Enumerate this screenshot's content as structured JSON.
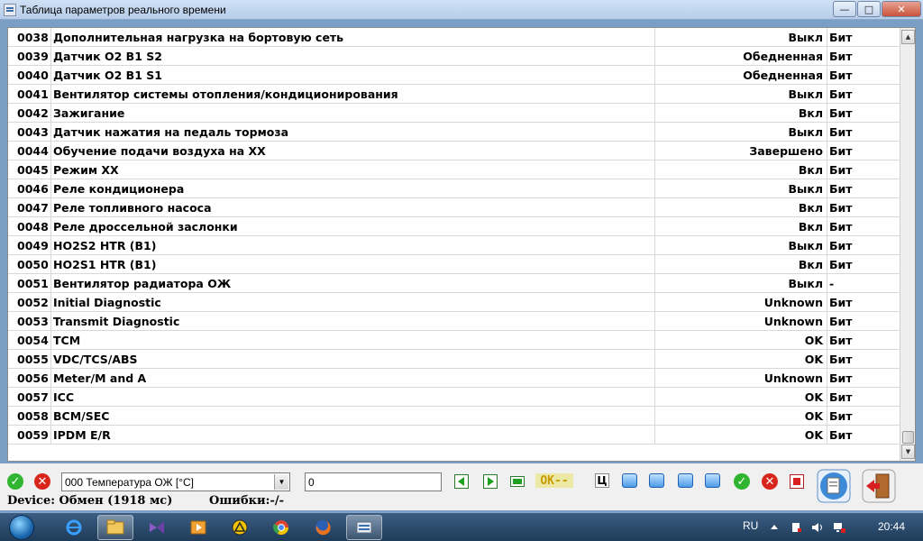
{
  "window": {
    "title": "Таблица параметров реального времени",
    "min_label": "—",
    "max_label": "□",
    "close_label": "✕"
  },
  "table": {
    "rows": [
      {
        "num": "0038",
        "name": "Дополнительная нагрузка на бортовую сеть",
        "value": "Выкл",
        "unit": "Бит"
      },
      {
        "num": "0039",
        "name": "Датчик O2 B1 S2",
        "value": "Обедненная",
        "unit": "Бит"
      },
      {
        "num": "0040",
        "name": "Датчик O2 B1 S1",
        "value": "Обедненная",
        "unit": "Бит"
      },
      {
        "num": "0041",
        "name": "Вентилятор системы отопления/кондиционирования",
        "value": "Выкл",
        "unit": "Бит"
      },
      {
        "num": "0042",
        "name": "Зажигание",
        "value": "Вкл",
        "unit": "Бит"
      },
      {
        "num": "0043",
        "name": "Датчик нажатия на педаль тормоза",
        "value": "Выкл",
        "unit": "Бит"
      },
      {
        "num": "0044",
        "name": "Обучение подачи воздуха на ХХ",
        "value": "Завершено",
        "unit": "Бит"
      },
      {
        "num": "0045",
        "name": "Режим ХХ",
        "value": "Вкл",
        "unit": "Бит"
      },
      {
        "num": "0046",
        "name": "Реле кондиционера",
        "value": "Выкл",
        "unit": "Бит"
      },
      {
        "num": "0047",
        "name": "Реле топливного насоса",
        "value": "Вкл",
        "unit": "Бит"
      },
      {
        "num": "0048",
        "name": "Реле дроссельной заслонки",
        "value": "Вкл",
        "unit": "Бит"
      },
      {
        "num": "0049",
        "name": "HO2S2 HTR (B1)",
        "value": "Выкл",
        "unit": "Бит"
      },
      {
        "num": "0050",
        "name": "HO2S1 HTR (B1)",
        "value": "Вкл",
        "unit": "Бит"
      },
      {
        "num": "0051",
        "name": "Вентилятор радиатора ОЖ",
        "value": "Выкл",
        "unit": "-"
      },
      {
        "num": "0052",
        "name": "Initial Diagnostic",
        "value": "Unknown",
        "unit": "Бит"
      },
      {
        "num": "0053",
        "name": "Transmit Diagnostic",
        "value": "Unknown",
        "unit": "Бит"
      },
      {
        "num": "0054",
        "name": "TCM",
        "value": "OK",
        "unit": "Бит"
      },
      {
        "num": "0055",
        "name": "VDC/TCS/ABS",
        "value": "OK",
        "unit": "Бит"
      },
      {
        "num": "0056",
        "name": "Meter/M and A",
        "value": "Unknown",
        "unit": "Бит"
      },
      {
        "num": "0057",
        "name": "ICC",
        "value": "OK",
        "unit": "Бит"
      },
      {
        "num": "0058",
        "name": "BCM/SEC",
        "value": "OK",
        "unit": "Бит"
      },
      {
        "num": "0059",
        "name": "IPDM E/R",
        "value": "OK",
        "unit": "Бит"
      }
    ]
  },
  "toolbar": {
    "param_select_value": "000 Температура ОЖ [°C]",
    "value_input": "0",
    "ok_badge": "OK--",
    "cyr_button": "Ц"
  },
  "status": {
    "device": "Device: Обмен (1918 мс)",
    "errors": "Ошибки:-/-"
  },
  "taskbar": {
    "lang": "RU",
    "clock": "20:44"
  },
  "icons": {
    "accept": "check-icon",
    "reject": "x-icon"
  }
}
